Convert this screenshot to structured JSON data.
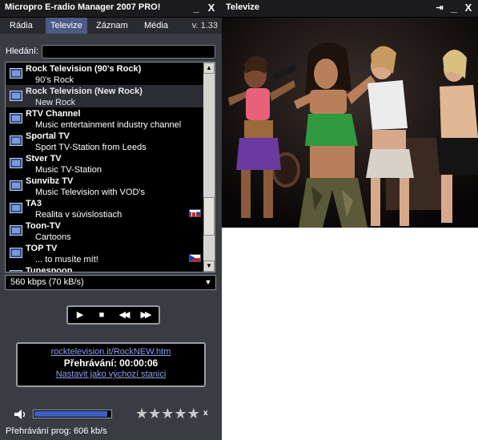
{
  "manager": {
    "title": "Micropro E-radio Manager 2007 PRO!",
    "window_buttons": [
      "_",
      "X"
    ]
  },
  "menu": {
    "items": [
      "Rádia",
      "Televize",
      "Záznam",
      "Média"
    ],
    "active": "Televize",
    "version": "v. 1.33"
  },
  "search": {
    "label": "Hledání:",
    "value": ""
  },
  "channels": [
    {
      "name": "Rock Television (90's Rock)",
      "desc": "90's Rock",
      "flag": ""
    },
    {
      "name": "Rock Television (New Rock)",
      "desc": "New Rock",
      "flag": "",
      "selected": true
    },
    {
      "name": "RTV Channel",
      "desc": "Music entertainment industry channel",
      "flag": ""
    },
    {
      "name": "Sportal TV",
      "desc": "Sport TV-Station from Leeds",
      "flag": ""
    },
    {
      "name": "Stver TV",
      "desc": "Music TV-Station",
      "flag": ""
    },
    {
      "name": "Sunvibz TV",
      "desc": "Music Television with VOD's",
      "flag": ""
    },
    {
      "name": "TA3",
      "desc": "Realita v súvislostiach",
      "flag": "sk"
    },
    {
      "name": "Toon-TV",
      "desc": "Cartoons",
      "flag": ""
    },
    {
      "name": "TOP TV",
      "desc": "... to musíte mít!",
      "flag": "cz"
    },
    {
      "name": "Tunespoon",
      "desc": "",
      "flag": ""
    }
  ],
  "bitrate_select": {
    "value": "560 kbps (70 kB/s)"
  },
  "transport": {
    "play": "▶",
    "stop": "■",
    "rewind": "◀◀",
    "forward": "▶▶"
  },
  "info": {
    "link": "rocktelevision.it/RockNEW.htm",
    "playing": "Přehrávání:  00:00:06",
    "default_link": "Nastavit jako výchozí stanici"
  },
  "volume": {
    "level": 0.96
  },
  "rating": {
    "stars": [
      "★",
      "★",
      "★",
      "★",
      "★"
    ],
    "clear": "x"
  },
  "status": "Přehrávání prog: 606 kb/s",
  "tv": {
    "title": "Televize",
    "window_buttons": [
      "⇥",
      "_",
      "X"
    ]
  },
  "colors": {
    "window_bg": "#3a3c43",
    "titlebar": "#1b1b1d",
    "accent": "#4b5a86",
    "link": "#8fa0e8",
    "volume_fill": "#3c5fc4"
  }
}
